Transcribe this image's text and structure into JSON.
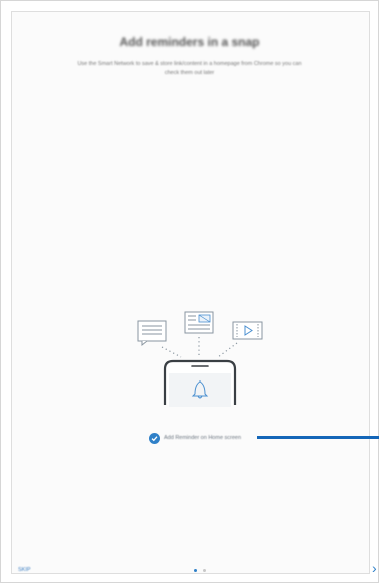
{
  "header": {
    "title": "Add reminders in a snap",
    "description": "Use the Smart Network to save & store link/content in a homepage from Chrome so you can check them out later"
  },
  "illustration": {
    "icons": [
      "message-icon",
      "article-icon",
      "video-icon",
      "phone-icon",
      "bell-icon"
    ]
  },
  "callout": {
    "text": "Add Reminder on Home screen"
  },
  "footer": {
    "skip_label": "SKIP",
    "page_count": 2,
    "current_page": 1,
    "next_symbol": "›"
  },
  "colors": {
    "accent": "#2f80c8",
    "callout_line": "#1466b8"
  }
}
